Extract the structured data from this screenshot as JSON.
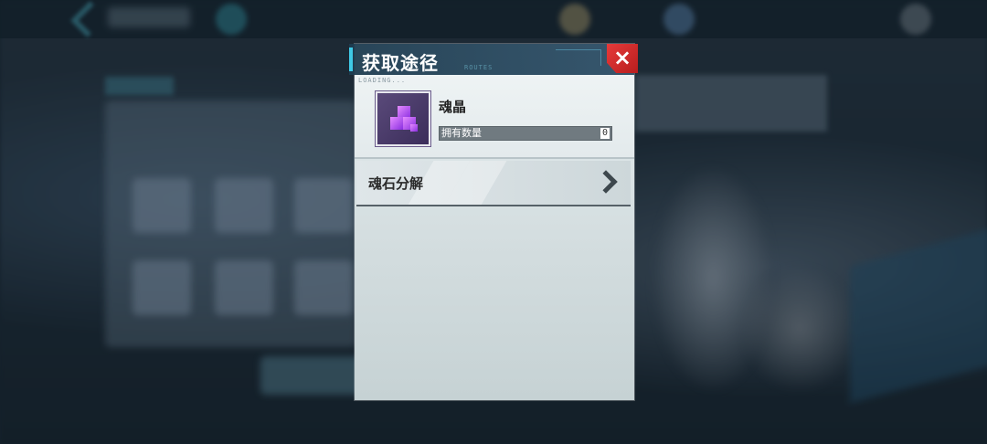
{
  "popup": {
    "title": "获取途径",
    "header_deco": "ROUTES",
    "loading_text": "LOADING...",
    "close_icon": "×"
  },
  "item": {
    "name": "魂晶",
    "own_label": "拥有数量",
    "own_count": "0",
    "icon": "purple-crystal-icon"
  },
  "sources": [
    {
      "label": "魂石分解",
      "icon": "chevron-right-icon"
    }
  ],
  "colors": {
    "accent": "#3fc9e6",
    "close": "#e63a3a",
    "crystal": "#b45ce8"
  }
}
